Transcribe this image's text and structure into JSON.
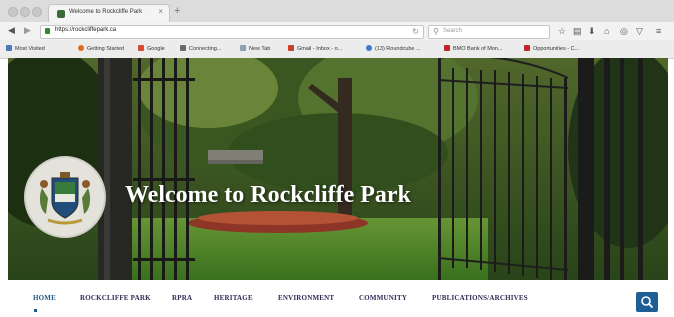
{
  "browser": {
    "tab_title": "Welcome to Rockcliffe Park",
    "url": "https://rockcliffepark.ca",
    "search_placeholder": "Search",
    "bookmarks": [
      "Most Visited",
      "Getting Started",
      "Google",
      "Connecting...",
      "New Tab",
      "Gmail - Inbox - o...",
      "(13) Roundcube ...",
      "BMO Bank of Mon...",
      "Opportunities - C..."
    ]
  },
  "hero": {
    "title": "Welcome to Rockcliffe Park"
  },
  "nav": {
    "items": [
      "HOME",
      "ROCKCLIFFE PARK",
      "RPRA",
      "HERITAGE",
      "ENVIRONMENT",
      "COMMUNITY",
      "PUBLICATIONS/ARCHIVES"
    ],
    "active": "HOME"
  },
  "colors": {
    "nav_text": "#2b2b55",
    "accent": "#1d5f95"
  },
  "icons": {
    "search": "search-icon",
    "lock": "lock-icon",
    "crest": "crest-logo"
  }
}
